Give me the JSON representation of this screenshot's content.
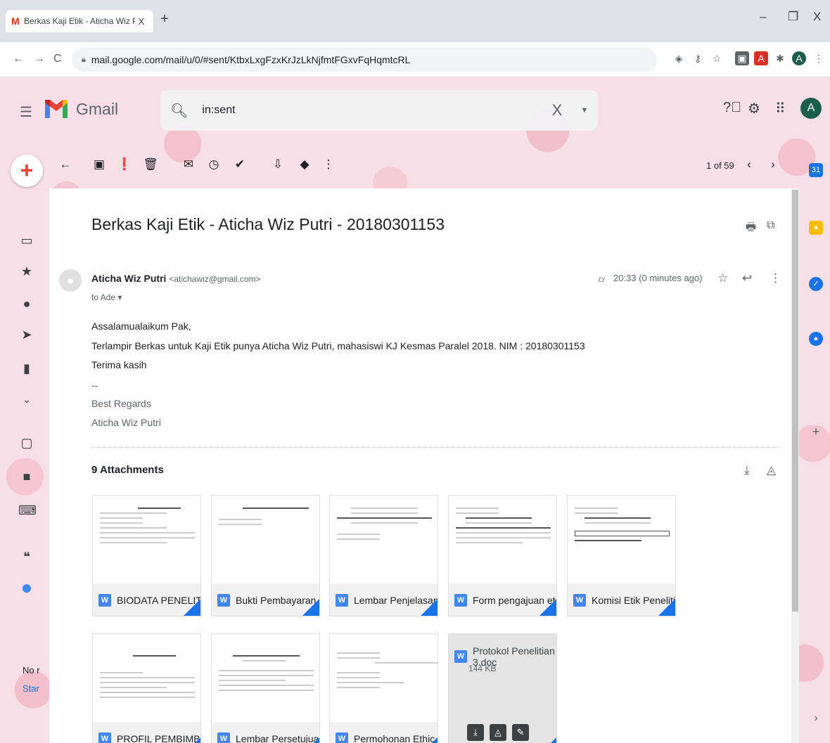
{
  "browser": {
    "tab_title": "Berkas Kaji Etik - Aticha Wiz Putr",
    "tab_close": "X",
    "new_tab": "+",
    "url": "mail.google.com/mail/u/0/#sent/KtbxLxgFzxKrJzLkNjfmtFGxvFqHqmtcRL",
    "win_minimize": "–",
    "win_maximize": "❐",
    "win_close": "X",
    "profile_initial": "A"
  },
  "gmail": {
    "brand": "Gmail",
    "search_value": "in:sent",
    "clear_icon": "X",
    "account_initial": "A"
  },
  "toolbar": {
    "pager": "1 of 59"
  },
  "message": {
    "subject": "Berkas Kaji Etik - Aticha Wiz Putri - 20180301153",
    "sender_name": "Aticha Wiz Putri",
    "sender_email": "<atichawiz@gmail.com>",
    "to": "to Ade ▾",
    "time": "20:33 (0 minutes ago)",
    "body": [
      "Assalamualaikum Pak,",
      "Terlampir Berkas untuk Kaji Etik punya Aticha Wiz Putri, mahasiswi KJ Kesmas Paralel 2018. NIM : 20180301153",
      "Terima kasih"
    ],
    "signature": [
      "--",
      "Best Regards",
      "Aticha Wiz Putri"
    ]
  },
  "attachments": {
    "heading": "9 Attachments",
    "items": [
      {
        "name": "BIODATA PENELITI..."
      },
      {
        "name": "Bukti Pembayaran ..."
      },
      {
        "name": "Lembar Penjelasan..."
      },
      {
        "name": "Form pengajuan et..."
      },
      {
        "name": "Komisi Etik Peneliti..."
      },
      {
        "name": "PROFIL PEMBIMBI..."
      },
      {
        "name": "Lembar Persetujua..."
      },
      {
        "name": "Permohonan Ethic..."
      }
    ],
    "hovered": {
      "name": "Protokol Penelitian 3.doc",
      "size": "144 KB"
    }
  },
  "left_bottom": {
    "line1": "No r",
    "line2": "Star"
  },
  "colors": {
    "accent": "#1a73e8",
    "gmail_red": "#ea4335",
    "avatar": "#1b5e4b",
    "word_blue": "#4285f4"
  }
}
